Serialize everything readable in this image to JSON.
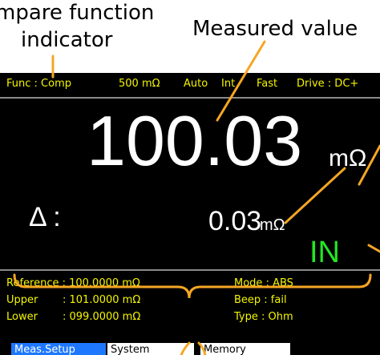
{
  "callouts": {
    "compare_line1": "mpare function",
    "compare_line2": "indicator",
    "measured": "Measured value"
  },
  "status_bar": {
    "func": "Func : Comp",
    "range": "500 mΩ",
    "range_mode": "Auto",
    "trigger": "Int",
    "speed": "Fast",
    "drive": "Drive : DC+"
  },
  "measurement": {
    "value": "100.03",
    "unit": "mΩ",
    "delta_label": "Δ :",
    "delta_value": "0.03",
    "delta_unit": "mΩ",
    "result": "IN"
  },
  "settings": {
    "reference": "Reference : 100.0000 mΩ",
    "upper_label": "Upper",
    "upper_value": ": 101.0000 mΩ",
    "lower_label": "Lower",
    "lower_value": ": 099.0000 mΩ",
    "mode": "Mode : ABS",
    "beep": "Beep : fail",
    "type": "Type : Ohm"
  },
  "menu_tabs": [
    "Meas.Setup",
    "System",
    "Memory"
  ],
  "colors": {
    "screen_bg": "#000000",
    "text_yellow": "#f5f500",
    "result_green": "#22e622",
    "callout_orange": "#f5a623",
    "tab_active_bg": "#1e78ff"
  }
}
